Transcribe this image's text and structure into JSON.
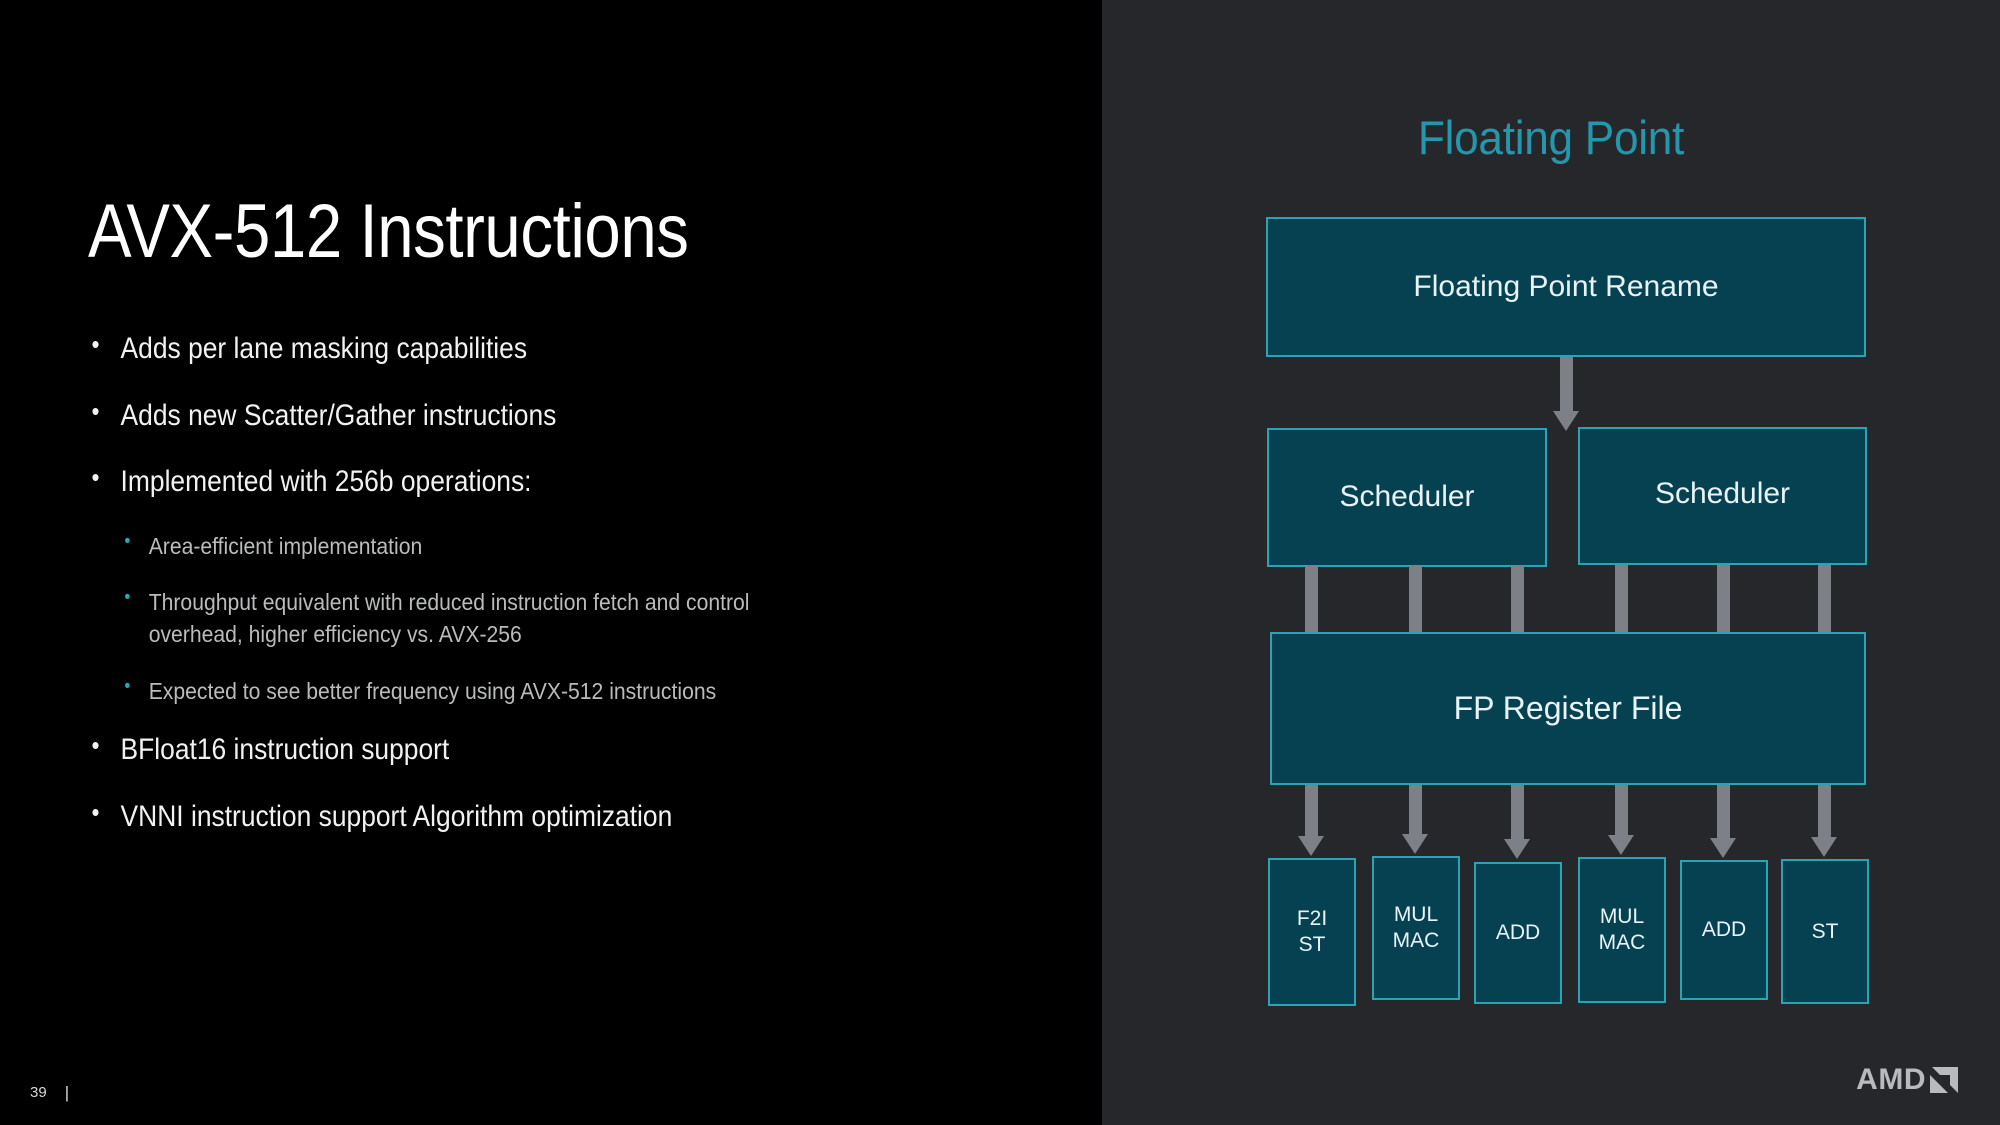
{
  "slide": {
    "title": "AVX-512 Instructions",
    "page_number": "39",
    "footer_separator": "|",
    "brand": "AMD",
    "colors": {
      "left_background": "#000000",
      "right_background": "#26272b",
      "accent_teal": "#2597ad",
      "box_fill": "#064152",
      "box_border": "#2aa3b5",
      "connector_gray": "#7d8086",
      "body_text": "#f2f2f2",
      "sub_text": "#b9bbbd"
    }
  },
  "bullets": [
    {
      "text": "Adds per lane masking capabilities",
      "level": 1
    },
    {
      "text": "Adds new Scatter/Gather instructions",
      "level": 1
    },
    {
      "text": "Implemented with 256b operations:",
      "level": 1
    },
    {
      "text": "Area-efficient implementation",
      "level": 2
    },
    {
      "text": "Throughput equivalent with reduced instruction fetch and control overhead, higher efficiency vs. AVX-256",
      "level": 2
    },
    {
      "text": "Expected to see better frequency using AVX-512 instructions",
      "level": 2
    },
    {
      "text": "BFloat16 instruction support",
      "level": 1
    },
    {
      "text": "VNNI instruction support Algorithm optimization",
      "level": 1
    }
  ],
  "diagram": {
    "heading": "Floating Point",
    "rename": "Floating Point Rename",
    "scheduler_left": "Scheduler",
    "scheduler_right": "Scheduler",
    "register_file": "FP Register File",
    "execution_units": [
      {
        "line1": "F2I",
        "line2": "ST"
      },
      {
        "line1": "MUL",
        "line2": "MAC"
      },
      {
        "line1": "ADD",
        "line2": ""
      },
      {
        "line1": "MUL",
        "line2": "MAC"
      },
      {
        "line1": "ADD",
        "line2": ""
      },
      {
        "line1": "ST",
        "line2": ""
      }
    ]
  }
}
